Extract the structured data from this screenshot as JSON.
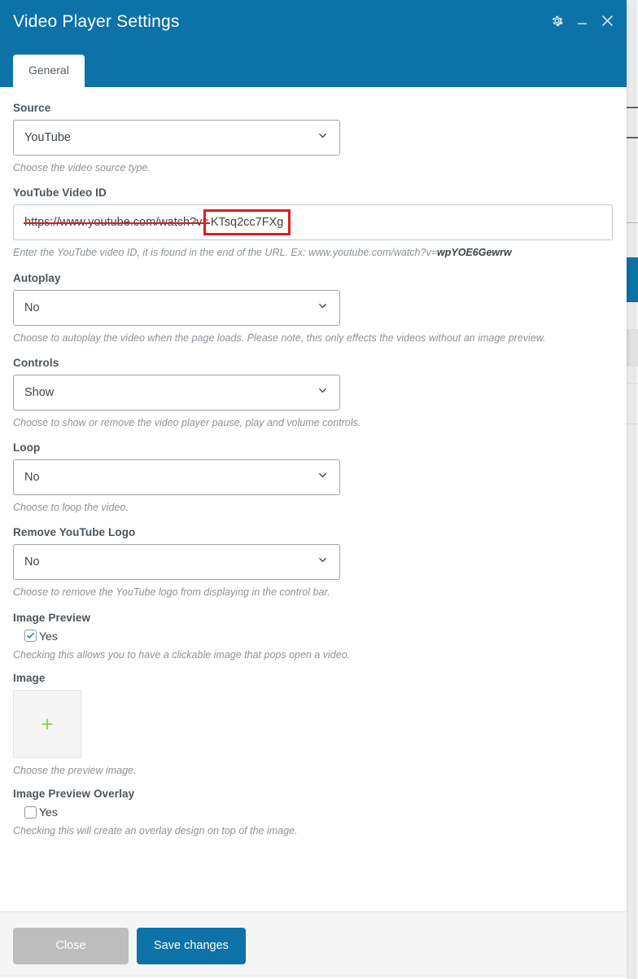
{
  "window": {
    "title": "Video Player Settings",
    "accent_color": "#0d72a8",
    "controls": [
      {
        "name": "settings-gear",
        "icon": "gear-icon",
        "label": "Settings"
      },
      {
        "name": "minimize",
        "icon": "minimize-icon",
        "label": "Minimize"
      },
      {
        "name": "close",
        "icon": "close-icon",
        "label": "Close"
      }
    ]
  },
  "tabs": [
    {
      "label": "General",
      "active": true
    }
  ],
  "fields": {
    "source": {
      "label": "Source",
      "value": "YouTube",
      "helper": "Choose the video source type."
    },
    "video_id": {
      "label": "YouTube Video ID",
      "value": "https://www.youtube.com/watch?v=KTsq2cc7FXg",
      "value_struck_part": "https://www.youtube.com/watch?v=",
      "value_boxed_part": "KTsq2cc7FXg",
      "helper_prefix": "Enter the YouTube video ID, it is found in the end of the URL. Ex: www.youtube.com/watch?v=",
      "helper_bold": "wpYOE6Gewrw",
      "annotation_color": "#e01b1b"
    },
    "autoplay": {
      "label": "Autoplay",
      "value": "No",
      "helper": "Choose to autoplay the video when the page loads. Please note, this only effects the videos without an image preview."
    },
    "controls": {
      "label": "Controls",
      "value": "Show",
      "helper": "Choose to show or remove the video player pause, play and volume controls."
    },
    "loop": {
      "label": "Loop",
      "value": "No",
      "helper": "Choose to loop the video."
    },
    "remove_logo": {
      "label": "Remove YouTube Logo",
      "value": "No",
      "helper": "Choose to remove the YouTube logo from displaying in the control bar."
    },
    "image_preview": {
      "label": "Image Preview",
      "checkbox_label": "Yes",
      "checked": true,
      "helper": "Checking this allows you to have a clickable image that pops open a video."
    },
    "image": {
      "label": "Image",
      "placeholder_icon": "plus-icon",
      "helper": "Choose the preview image."
    },
    "image_preview_overlay": {
      "label": "Image Preview Overlay",
      "checkbox_label": "Yes",
      "checked": false,
      "helper": "Checking this will create an overlay design on top of the image."
    }
  },
  "footer": {
    "close_label": "Close",
    "save_label": "Save changes"
  }
}
